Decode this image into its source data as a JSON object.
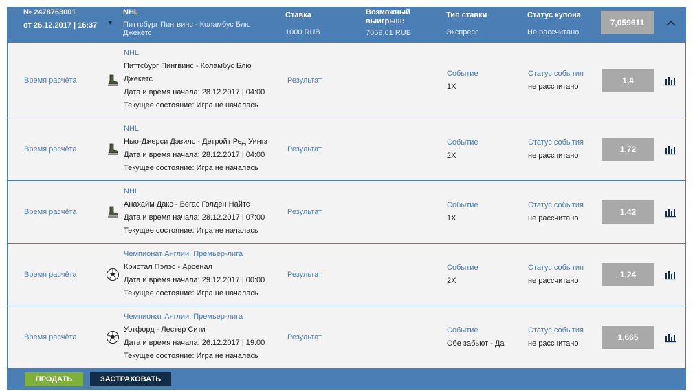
{
  "header": {
    "coupon_id": "№ 2478763001",
    "date": "от 26.12.2017 | 16:37",
    "league": "NHL",
    "event": "Питтсбург Пингвинс - Коламбус Блю Джекетс",
    "stake_label": "Ставка",
    "stake_value": "1000 RUB",
    "win_label": "Возможный выигрыш:",
    "win_value": "7059,61 RUB",
    "type_label": "Тип ставки",
    "type_value": "Экспресс",
    "status_label": "Статус купона",
    "status_value": "Не рассчитано",
    "total_odds": "7,059611"
  },
  "rows": [
    {
      "calc": "Время расчёта",
      "sport_icon": "hockey-skate-icon",
      "league": "NHL",
      "event": "Питтсбург Пингвинс - Коламбус Блю Джекетс",
      "start": "Дата и время начала: 28.12.2017 | 04:00",
      "state": "Текущее состояние: Игра не началась",
      "result": "Результат",
      "event_label": "Событие",
      "event_value": "1X",
      "status_label": "Статус события",
      "status_value": "не рассчитано",
      "odds": "1,4"
    },
    {
      "calc": "Время расчёта",
      "sport_icon": "hockey-skate-icon",
      "league": "NHL",
      "event": "Нью-Джерси Дэвилс - Детройт Ред Уингз",
      "start": "Дата и время начала: 28.12.2017 | 04:00",
      "state": "Текущее состояние: Игра не началась",
      "result": "Результат",
      "event_label": "Событие",
      "event_value": "2X",
      "status_label": "Статус события",
      "status_value": "не рассчитано",
      "odds": "1,72"
    },
    {
      "calc": "Время расчёта",
      "sport_icon": "hockey-skate-icon",
      "league": "NHL",
      "event": "Анахайм Дакс - Вегас Голден Найтс",
      "start": "Дата и время начала: 28.12.2017 | 07:00",
      "state": "Текущее состояние: Игра не началась",
      "result": "Результат",
      "event_label": "Событие",
      "event_value": "1X",
      "status_label": "Статус события",
      "status_value": "не рассчитано",
      "odds": "1,42"
    },
    {
      "calc": "Время расчёта",
      "sport_icon": "soccer-ball-icon",
      "league": "Чемпионат Англии. Премьер-лига",
      "event": "Кристал Пэлэс - Арсенал",
      "start": "Дата и время начала: 29.12.2017 | 00:00",
      "state": "Текущее состояние: Игра не началась",
      "result": "Результат",
      "event_label": "Событие",
      "event_value": "2X",
      "status_label": "Статус события",
      "status_value": "не рассчитано",
      "odds": "1,24"
    },
    {
      "calc": "Время расчёта",
      "sport_icon": "soccer-ball-icon",
      "league": "Чемпионат Англии. Премьер-лига",
      "event": "Уотфорд - Лестер Сити",
      "start": "Дата и время начала: 26.12.2017 | 19:00",
      "state": "Текущее состояние: Игра не началась",
      "result": "Результат",
      "event_label": "Событие",
      "event_value": "Обе забьют - Да",
      "status_label": "Статус события",
      "status_value": "не рассчитано",
      "odds": "1,665"
    }
  ],
  "footer": {
    "sell_label": "ПРОДАТЬ",
    "insure_label": "ЗАСТРАХОВАТЬ"
  },
  "colors": {
    "header_bg": "#4a7eb5",
    "odds_bg": "#a9a9a9",
    "sell_bg": "#7fb03a",
    "insure_bg": "#132c47",
    "link": "#4a7eb5"
  }
}
